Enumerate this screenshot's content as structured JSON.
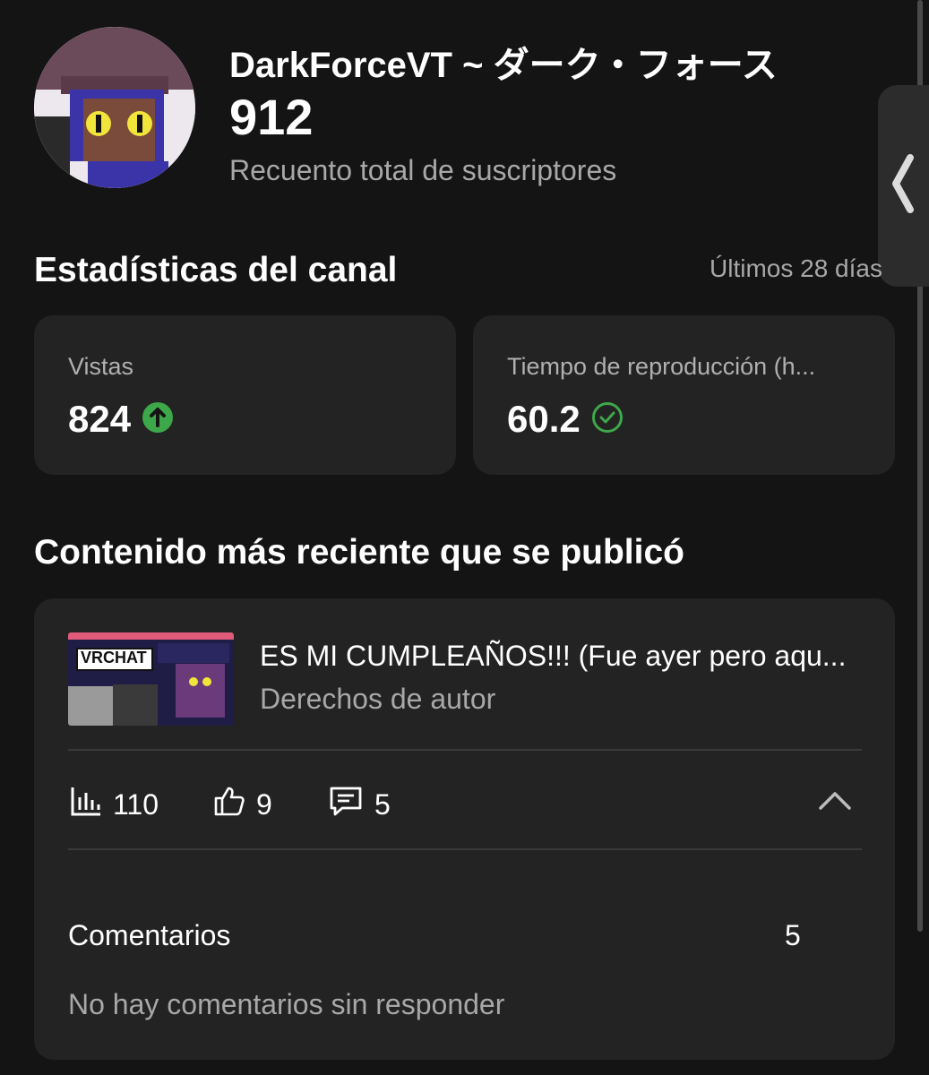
{
  "channel": {
    "name": "DarkForceVT ~ ダーク・フォース",
    "subscriber_count": "912",
    "subscriber_label": "Recuento total de suscriptores"
  },
  "stats": {
    "title": "Estadísticas del canal",
    "period": "Últimos 28 días",
    "cards": [
      {
        "label": "Vistas",
        "value": "824",
        "indicator": "arrow-up-circle-icon",
        "indicator_color": "#3da84a"
      },
      {
        "label": "Tiempo de reproducción (h...",
        "value": "60.2",
        "indicator": "check-circle-icon",
        "indicator_color": "#3da84a"
      }
    ]
  },
  "recent": {
    "title": "Contenido más reciente que se publicó",
    "video": {
      "title": "ES MI CUMPLEAÑOS!!! (Fue ayer pero aqu...",
      "subtitle": "Derechos de autor",
      "thumbnail_text": "VRCHAT"
    },
    "metrics": {
      "views": "110",
      "likes": "9",
      "comments": "5"
    },
    "comments_section": {
      "label": "Comentarios",
      "count": "5",
      "empty_message": "No hay comentarios sin responder"
    }
  }
}
